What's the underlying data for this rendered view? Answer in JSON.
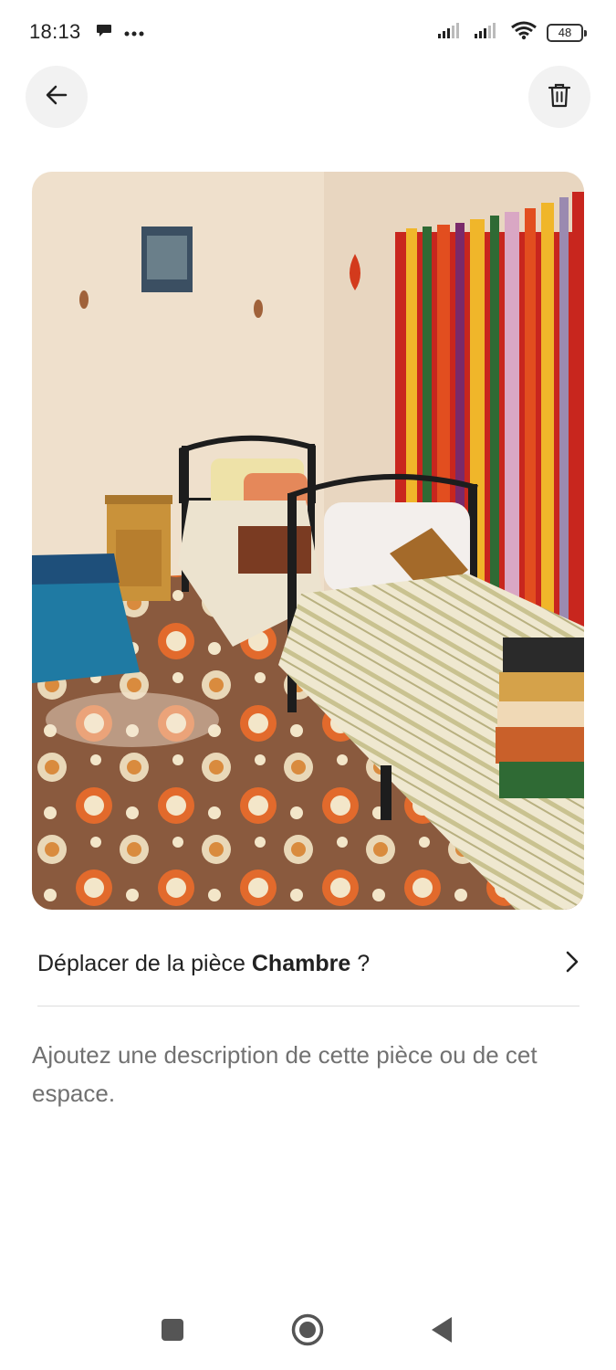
{
  "status_bar": {
    "time": "18:13",
    "battery": "48",
    "icons": [
      "chat-bubble-icon",
      "more-dots-icon",
      "signal-icon",
      "signal-icon",
      "wifi-icon",
      "battery-icon"
    ]
  },
  "top_bar": {
    "back_icon": "arrow-left-icon",
    "delete_icon": "trash-icon"
  },
  "photo": {
    "subject": "bedroom",
    "colors": {
      "wall": "#efe0cc",
      "carpet": "#8a5a3e",
      "tapestry_red": "#c8261e",
      "tapestry_yellow": "#f0b62a"
    }
  },
  "move_room": {
    "prefix": "Déplacer de la pièce ",
    "room_name": "Chambre",
    "suffix": " ?",
    "icon": "chevron-right-icon"
  },
  "description": {
    "placeholder": "Ajoutez une description de cette pièce ou de cet espace."
  },
  "nav_bar": {
    "icons": [
      "square-icon",
      "home-circle-icon",
      "back-triangle-icon"
    ]
  }
}
